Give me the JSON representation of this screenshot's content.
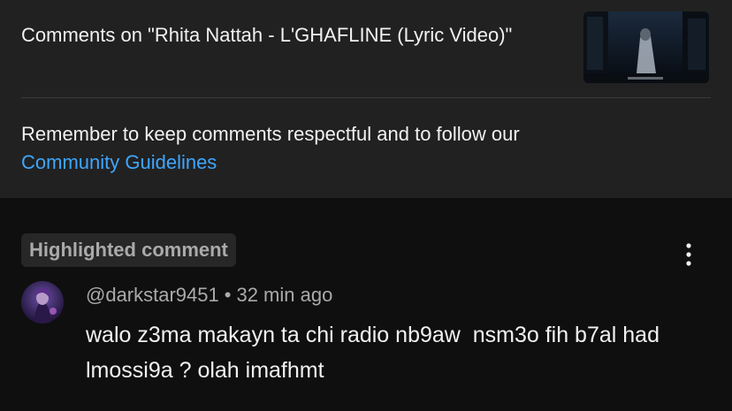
{
  "header": {
    "title": "Comments on \"Rhita Nattah - L'GHAFLINE (Lyric Video)\"",
    "thumbnail_icon": "video-thumbnail"
  },
  "notice": {
    "text": "Remember to keep comments respectful and to follow our",
    "link_label": "Community Guidelines"
  },
  "comment": {
    "badge": "Highlighted comment",
    "author": "@darkstar9451",
    "separator": "•",
    "time": "32 min ago",
    "text": "walo z3ma makayn ta chi radio nb9aw  nsm3o fih b7al had lmossi9a ? olah imafhmt",
    "menu_icon": "more-vert-icon"
  },
  "colors": {
    "link": "#3ea6ff",
    "panel": "#212121",
    "background": "#0f0f0f",
    "secondary_text": "#aaaaaa"
  }
}
